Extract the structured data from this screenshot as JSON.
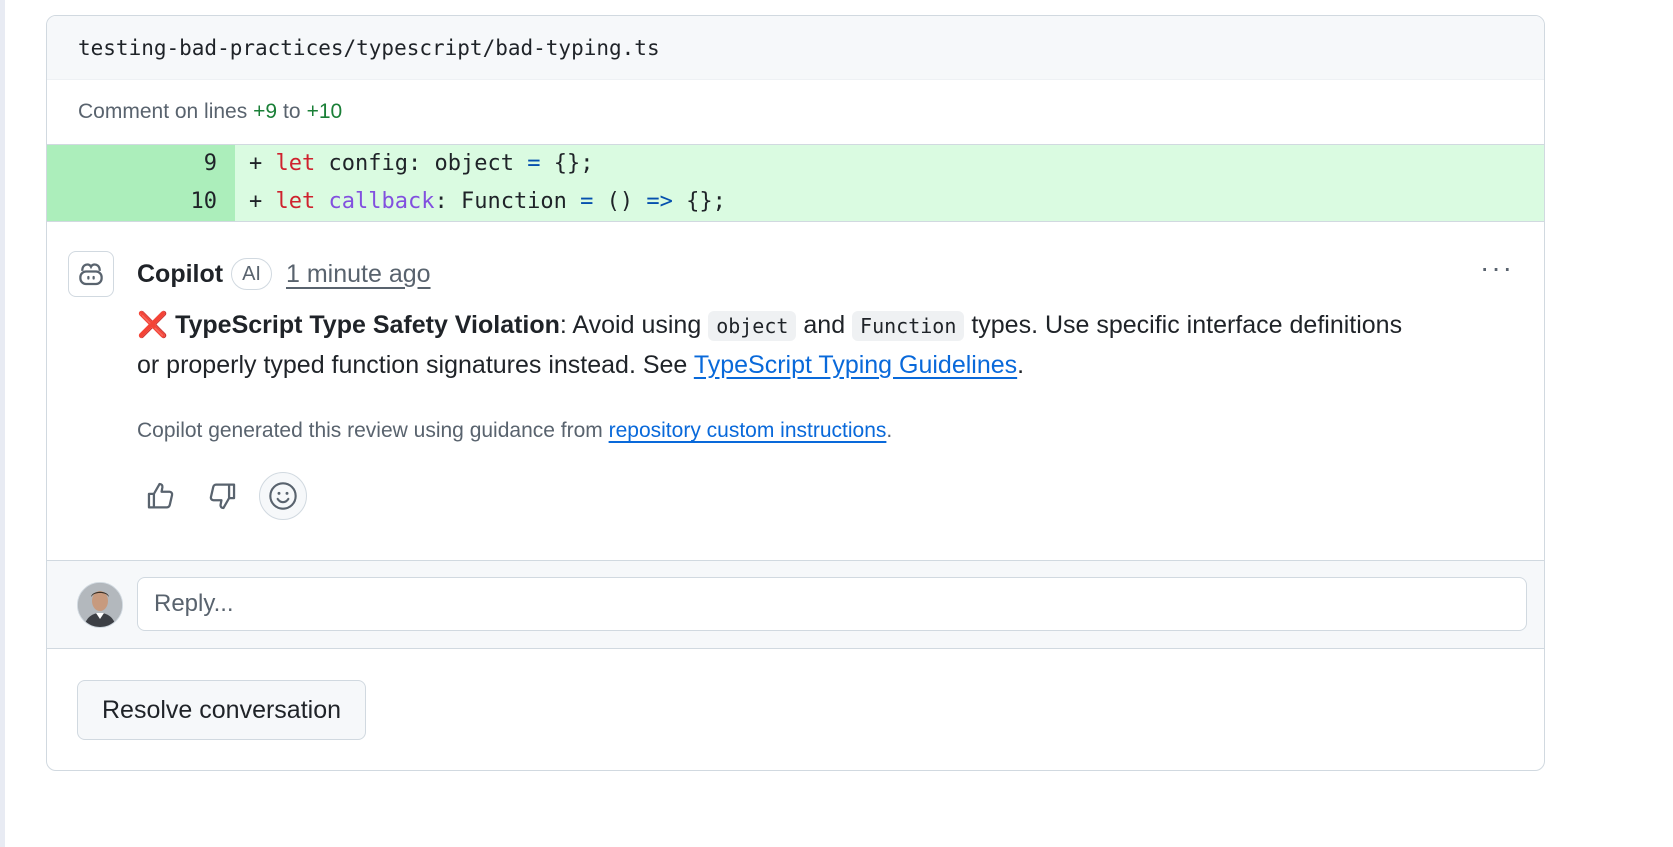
{
  "file": {
    "path": "testing-bad-practices/typescript/bad-typing.ts"
  },
  "comment_range": {
    "prefix": "Comment on lines",
    "start": "+9",
    "separator": "to",
    "end": "+10"
  },
  "diff": {
    "lines": [
      {
        "number": "9",
        "marker": "+",
        "kw": "let",
        "name": "config",
        "type_part": ": object ",
        "eq": "=",
        "rest": " {};"
      },
      {
        "number": "10",
        "marker": "+",
        "kw": "let",
        "name": "callback",
        "type_part": ": Function ",
        "eq": "=",
        "mid": " () ",
        "arrow": "=>",
        "rest": " {};"
      }
    ]
  },
  "comment": {
    "author": "Copilot",
    "badge": "AI",
    "timestamp": "1 minute ago",
    "more_label": "···",
    "mark": "❌",
    "title": "TypeScript Type Safety Violation",
    "text_1": ": Avoid using ",
    "code_1": "object",
    "text_2": " and ",
    "code_2": "Function",
    "text_3": " types. Use specific interface definitions or properly typed function signatures instead. See ",
    "link": "TypeScript Typing Guidelines",
    "text_4": ".",
    "note_prefix": "Copilot generated this review using guidance from ",
    "note_link": "repository custom instructions",
    "note_suffix": "."
  },
  "reactions": {
    "thumbs_up_icon": "thumbs-up-icon",
    "thumbs_down_icon": "thumbs-down-icon",
    "smiley_icon": "smiley-icon"
  },
  "reply": {
    "placeholder": "Reply..."
  },
  "actions": {
    "resolve_label": "Resolve conversation"
  },
  "colors": {
    "added_num_bg": "#aceebb",
    "added_code_bg": "#dafbe1",
    "link": "#0969da",
    "keyword": "#cf222e",
    "function_name": "#8250df",
    "line_ref": "#1a7f37"
  }
}
